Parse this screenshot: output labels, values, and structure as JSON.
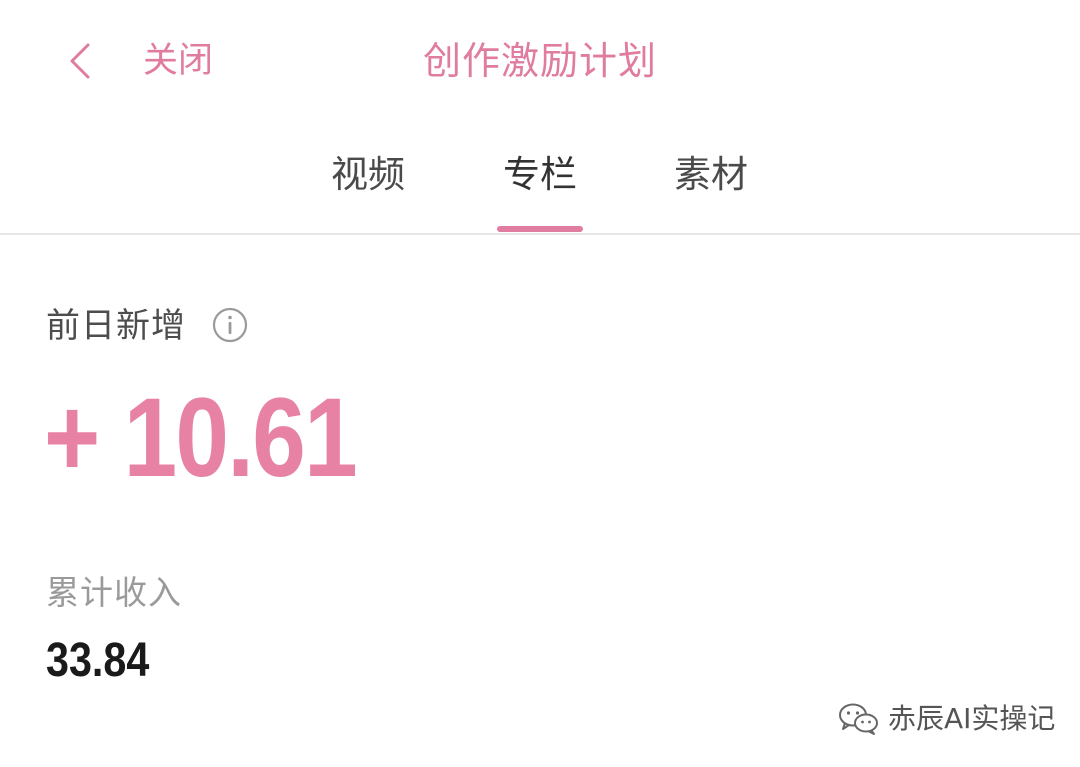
{
  "header": {
    "back_icon": "chevron-left-icon",
    "close_label": "关闭",
    "title": "创作激励计划"
  },
  "tabs": [
    {
      "label": "视频",
      "active": false
    },
    {
      "label": "专栏",
      "active": true
    },
    {
      "label": "素材",
      "active": false
    }
  ],
  "stats": {
    "daily_label": "前日新增",
    "info_icon": "info-icon",
    "daily_value": "+ 10.61",
    "total_label": "累计收入",
    "total_value": "33.84"
  },
  "watermark": {
    "icon": "wechat-icon",
    "text": "赤辰AI实操记"
  },
  "colors": {
    "accent": "#e07c9f",
    "value_pink": "#e882a4",
    "text_dark": "#1a1a1a",
    "text_gray": "#9a9a9a",
    "divider": "#e6e6e6"
  }
}
